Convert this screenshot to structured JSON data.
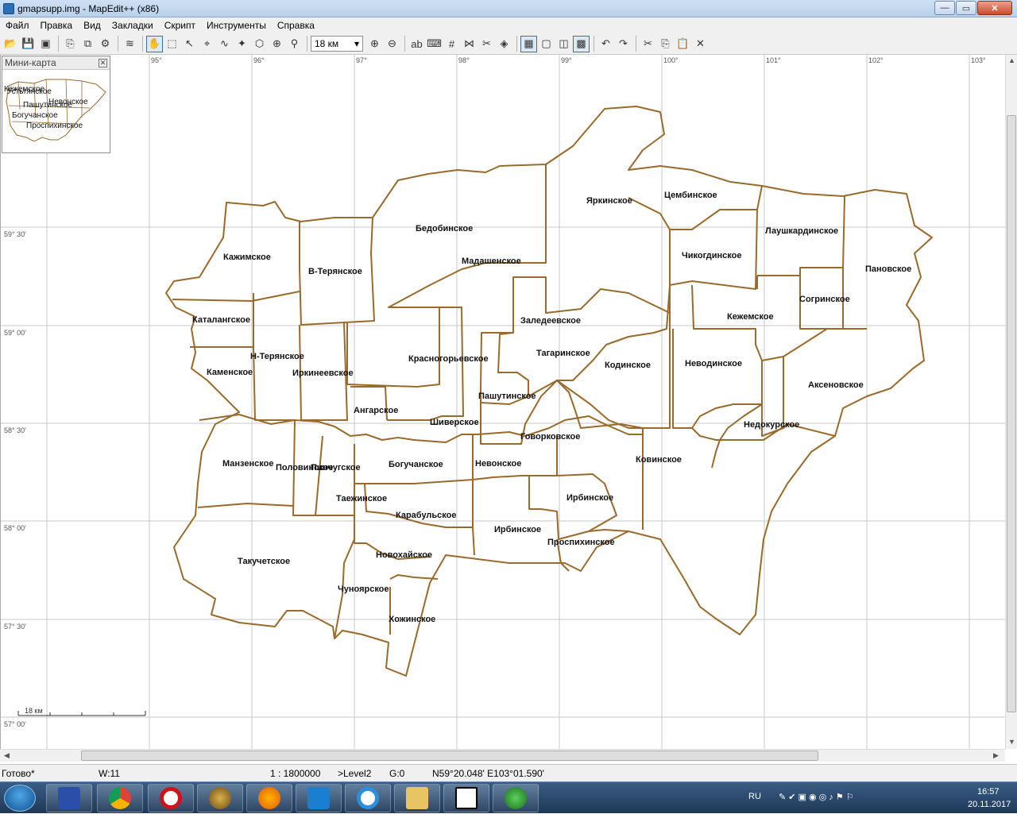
{
  "window": {
    "title": "gmapsupp.img - MapEdit++ (x86)",
    "buttons": {
      "minimize": "—",
      "maximize": "▭",
      "close": "✕"
    }
  },
  "menu": [
    "Файл",
    "Правка",
    "Вид",
    "Закладки",
    "Скрипт",
    "Инструменты",
    "Справка"
  ],
  "toolbar": {
    "scale_select": "18 км",
    "icons": [
      "open-icon",
      "save-icon",
      "save-as-icon",
      "import-icon",
      "export-icon",
      "properties-icon",
      "tracks-icon",
      "pan-hand-icon",
      "zoom-rect-icon",
      "select-arrow-icon",
      "edit-node-icon",
      "polyline-icon",
      "magic-wand-icon",
      "polygon-select-icon",
      "route-icon",
      "poi-icon",
      "zoom-in-icon",
      "zoom-out-icon",
      "label-icon",
      "keyboard-icon",
      "grid-icon",
      "snap-icon",
      "split-icon",
      "layer-icon",
      "view-1-icon",
      "view-2-icon",
      "view-3-icon",
      "view-4-icon",
      "undo-icon",
      "redo-icon",
      "cut-icon",
      "copy-icon",
      "paste-icon",
      "delete-icon"
    ]
  },
  "minimap": {
    "title": "Мини-карта",
    "labels": [
      "Кежемское",
      "Устьтянское",
      "Невонское",
      "Пашутинское",
      "Богучанское",
      "Проспихинское"
    ]
  },
  "map": {
    "longitudes": [
      "95°",
      "96°",
      "97°",
      "98°",
      "99°",
      "100°",
      "101°",
      "102°",
      "103°"
    ],
    "latitudes": [
      "59° 30'",
      "59° 00'",
      "58° 30'",
      "58° 00'",
      "57° 30'",
      "57° 00'"
    ],
    "scale_bar": "18 км",
    "regions": [
      "Бедобинское",
      "Яркинское",
      "Цембинское",
      "Лаушкардинское",
      "Пановское",
      "Кажимское",
      "В-Терянское",
      "Мадашенское",
      "Чикогдинское",
      "Согринское",
      "Каталангское",
      "Заледеевское",
      "Кежемское",
      "Н-Терянское",
      "Красногорьевское",
      "Тагаринское",
      "Кодинское",
      "Неводинское",
      "Аксеновское",
      "Каменское",
      "Иркинеевское",
      "Пашутинское",
      "Ангарское",
      "Шиверское",
      "Недокурское",
      "Говорковское",
      "Манзенское",
      "Половинское",
      "Пинчугское",
      "Богучанское",
      "Невонское",
      "Ковинское",
      "Таежинское",
      "Ирбинское",
      "Карабульское",
      "Ирбинское",
      "Проспихинское",
      "Такучетское",
      "Новохайское",
      "Чуноярское",
      "Хожинское"
    ]
  },
  "status": {
    "state": "Готово*",
    "w": "W:11",
    "scale": "1 : 1800000",
    "level": ">Level2",
    "g": "G:0",
    "coords": "N59°20.048' E103°01.590'"
  },
  "taskbar": {
    "apps": [
      "save-app",
      "chrome-app",
      "opera-app",
      "target-app",
      "firefox-app",
      "maxthon-app",
      "ie-app",
      "explorer-app",
      "7zip-app",
      "mapedit-app"
    ],
    "lang": "RU",
    "time": "16:57",
    "date": "20.11.2017"
  }
}
